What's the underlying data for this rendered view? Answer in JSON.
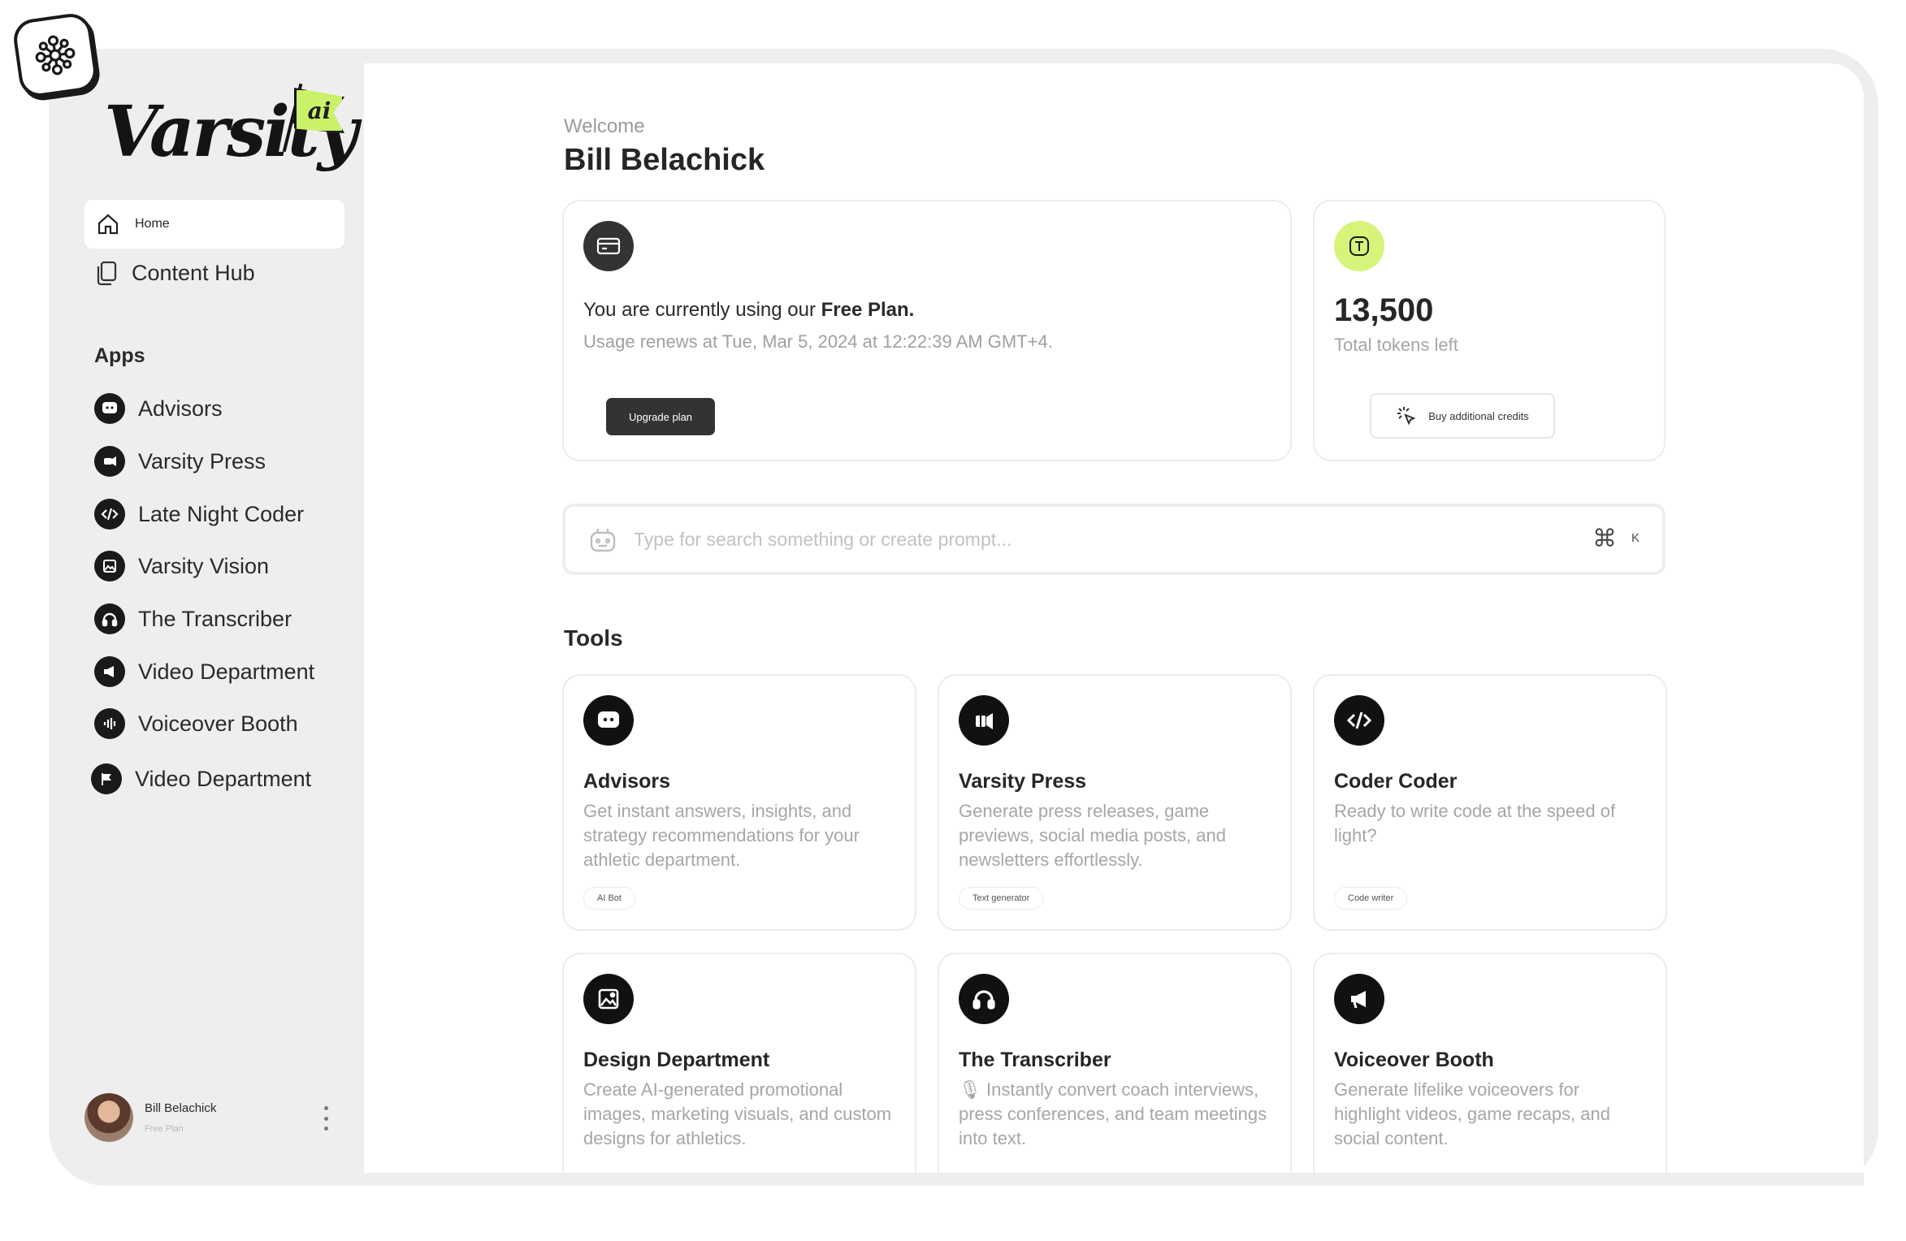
{
  "brand": {
    "name": "Varsity",
    "badge": "ai"
  },
  "sidebar": {
    "home_label": "Home",
    "content_hub_label": "Content Hub",
    "apps_heading": "Apps",
    "apps": [
      {
        "label": "Advisors",
        "icon": "chat-icon"
      },
      {
        "label": "Varsity Press",
        "icon": "press-icon"
      },
      {
        "label": "Late Night Coder",
        "icon": "code-icon"
      },
      {
        "label": "Varsity Vision",
        "icon": "image-icon"
      },
      {
        "label": "The Transcriber",
        "icon": "headphones-icon"
      },
      {
        "label": "Video Department",
        "icon": "megaphone-icon"
      },
      {
        "label": "Voiceover Booth",
        "icon": "waveform-icon"
      },
      {
        "label": "Video Department",
        "icon": "flag-icon"
      }
    ],
    "user": {
      "name": "Bill Belachick",
      "plan": "Free Plan"
    }
  },
  "main": {
    "welcome": "Welcome",
    "user_name": "Bill Belachick",
    "plan_card": {
      "line_prefix": "You are currently using our ",
      "plan_name": "Free Plan.",
      "renewal": "Usage renews at Tue, Mar 5, 2024 at 12:22:39 AM GMT+4.",
      "upgrade_label": "Upgrade plan"
    },
    "tokens_card": {
      "count": "13,500",
      "label": "Total tokens left",
      "buy_label": "Buy additional credits",
      "accent": "#d6f47a"
    },
    "search": {
      "placeholder": "Type for search something or create prompt...",
      "shortcut_symbol": "⌘",
      "shortcut_key": "K"
    },
    "tools_heading": "Tools",
    "tools": [
      {
        "title": "Advisors",
        "desc": "Get instant answers, insights, and strategy recommendations for your athletic department.",
        "tag": "AI Bot",
        "icon": "chat-icon"
      },
      {
        "title": "Varsity Press",
        "desc": "Generate press releases, game previews, social media posts, and newsletters effortlessly.",
        "tag": "Text generator",
        "icon": "press-icon"
      },
      {
        "title": "Coder Coder",
        "desc": "Ready to write code at the speed of light?",
        "tag": "Code writer",
        "icon": "code-icon"
      },
      {
        "title": "Design Department",
        "desc": "Create AI-generated promotional images, marketing visuals, and custom designs for athletics.",
        "tag": "",
        "icon": "image-icon"
      },
      {
        "title": "The Transcriber",
        "desc": "🎙 Instantly convert coach interviews, press conferences, and team meetings into text.",
        "tag": "",
        "icon": "headphones-icon"
      },
      {
        "title": "Voiceover Booth",
        "desc": "Generate lifelike voiceovers for highlight videos, game recaps, and social content.",
        "tag": "",
        "icon": "megaphone-icon"
      }
    ]
  }
}
